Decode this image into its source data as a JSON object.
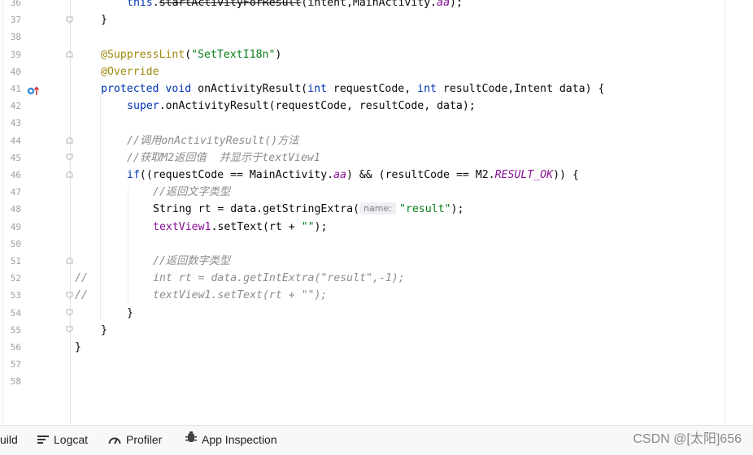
{
  "editor": {
    "line_numbers": [
      "36",
      "37",
      "38",
      "39",
      "40",
      "41",
      "42",
      "43",
      "44",
      "45",
      "46",
      "47",
      "48",
      "49",
      "50",
      "51",
      "52",
      "53",
      "54",
      "55",
      "56",
      "57",
      "58"
    ],
    "l36": {
      "kw_this": "this",
      "dot": ".",
      "method": "startActivityForResult",
      "rest1": "(intent,MainActivity.",
      "fld": "aa",
      "rest2": ");"
    },
    "l37": {
      "text": "}"
    },
    "l39": {
      "ann": "@SuppressLint",
      "p1": "(",
      "str": "\"SetTextI18n\"",
      "p2": ")"
    },
    "l40": {
      "ann": "@Override"
    },
    "l41": {
      "kw1": "protected",
      "kw2": "void",
      "rest1": "onActivityResult(",
      "kw3": "int",
      "rest2": "requestCode, ",
      "kw4": "int",
      "rest3": "resultCode,Intent data) {"
    },
    "l42": {
      "kw": "super",
      "rest": ".onActivityResult(requestCode, resultCode, data);"
    },
    "l44": {
      "text": "//调用onActivityResult()方法"
    },
    "l45": {
      "text": "//获取M2返回值  并显示于textView1"
    },
    "l46": {
      "kw": "if",
      "rest1": "((requestCode == MainActivity.",
      "fld": "aa",
      "rest2": ") && (resultCode == M2.",
      "static": "RESULT_OK",
      "rest3": ")) {"
    },
    "l47": {
      "text": "//返回文字类型"
    },
    "l48": {
      "pre": "String rt = data.getStringExtra(",
      "hint": "name:",
      "str": "\"result\"",
      "post": ");"
    },
    "l49": {
      "fld": "textView1",
      "rest1": ".setText(rt + ",
      "str": "\"\"",
      "rest2": ");"
    },
    "l51": {
      "text": "//返回数字类型"
    },
    "l52": {
      "marker": "//",
      "text": "int rt = data.getIntExtra(\"result\",-1);"
    },
    "l53": {
      "marker": "//",
      "text": "textView1.setText(rt + \"\");"
    },
    "l54": {
      "text": "}"
    },
    "l55": {
      "text": "}"
    },
    "l56": {
      "text": "}"
    }
  },
  "bottom_bar": {
    "build_label": "uild",
    "logcat_label": "Logcat",
    "profiler_label": "Profiler",
    "app_inspection_label": "App Inspection",
    "watermark": "CSDN @[太阳]656"
  },
  "colors": {
    "keyword": "#0033b3",
    "annotation": "#9e880d",
    "string": "#067d17",
    "field": "#871094",
    "comment": "#8c8c8c",
    "line_number": "#9aa0a6"
  }
}
